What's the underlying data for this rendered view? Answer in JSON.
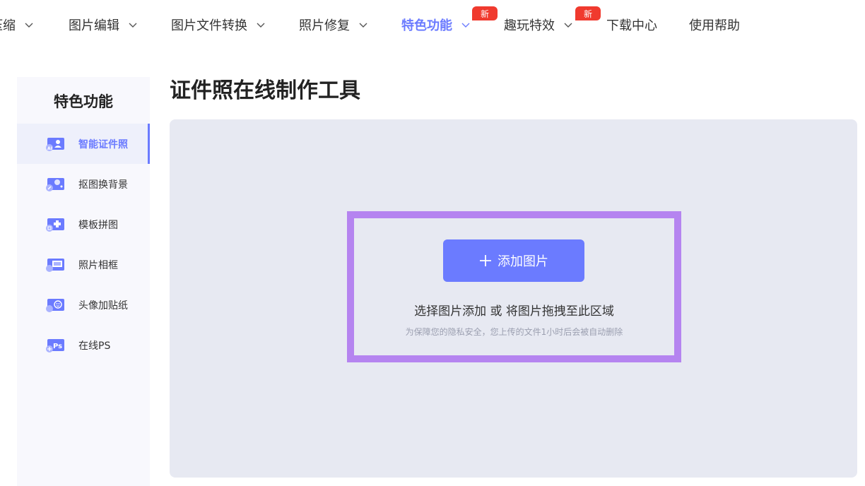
{
  "colors": {
    "accent": "#6b7bff",
    "badge": "#f03a2e",
    "drop_border": "#b584f0",
    "upload_bg": "#e7e9f2",
    "sidebar_bg": "#f8f8fd"
  },
  "nav": {
    "items": [
      {
        "label": "压缩",
        "has_dropdown": true,
        "active": false,
        "badge": ""
      },
      {
        "label": "图片编辑",
        "has_dropdown": true,
        "active": false,
        "badge": ""
      },
      {
        "label": "图片文件转换",
        "has_dropdown": true,
        "active": false,
        "badge": ""
      },
      {
        "label": "照片修复",
        "has_dropdown": true,
        "active": false,
        "badge": ""
      },
      {
        "label": "特色功能",
        "has_dropdown": true,
        "active": true,
        "badge": "新"
      },
      {
        "label": "趣玩特效",
        "has_dropdown": true,
        "active": false,
        "badge": "新"
      },
      {
        "label": "下载中心",
        "has_dropdown": false,
        "active": false,
        "badge": ""
      },
      {
        "label": "使用帮助",
        "has_dropdown": false,
        "active": false,
        "badge": ""
      }
    ]
  },
  "sidebar": {
    "title": "特色功能",
    "items": [
      {
        "label": "智能证件照",
        "icon": "id-photo-icon",
        "active": true
      },
      {
        "label": "抠图换背景",
        "icon": "cutout-background-icon",
        "active": false
      },
      {
        "label": "模板拼图",
        "icon": "template-collage-icon",
        "active": false
      },
      {
        "label": "照片相框",
        "icon": "photo-frame-icon",
        "active": false
      },
      {
        "label": "头像加贴纸",
        "icon": "avatar-sticker-icon",
        "active": false
      },
      {
        "label": "在线PS",
        "icon": "online-ps-icon",
        "active": false
      }
    ]
  },
  "main": {
    "title": "证件照在线制作工具",
    "upload": {
      "button_label": "添加图片",
      "button_icon": "plus-icon",
      "hint": "选择图片添加 或 将图片拖拽至此区域",
      "privacy_note": "为保障您的隐私安全，您上传的文件1小时后会被自动删除"
    }
  }
}
